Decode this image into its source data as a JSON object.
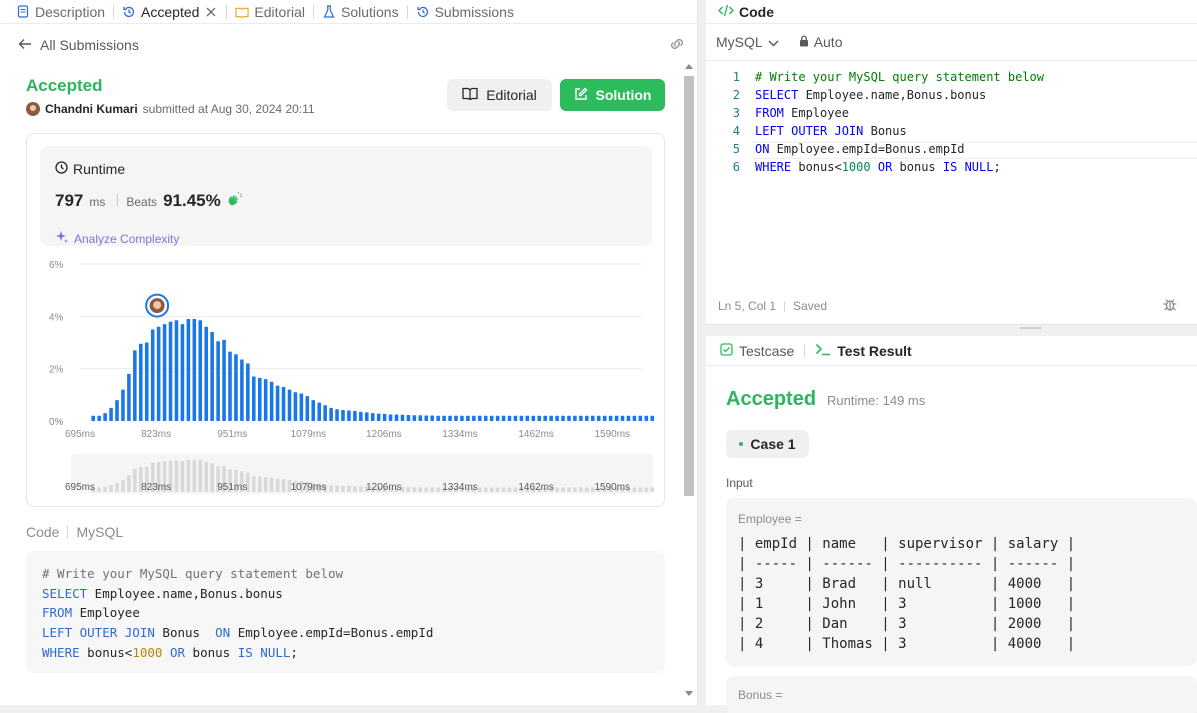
{
  "left_tabs": [
    {
      "label": "Description"
    },
    {
      "label": "Accepted"
    },
    {
      "label": "Editorial"
    },
    {
      "label": "Solutions"
    },
    {
      "label": "Submissions"
    }
  ],
  "subbar": {
    "back_label": "All Submissions"
  },
  "submission": {
    "status": "Accepted",
    "user": "Chandni Kumari",
    "submitted_text": "submitted at Aug 30, 2024 20:11",
    "editorial_button": "Editorial",
    "solution_button": "Solution"
  },
  "runtime": {
    "label": "Runtime",
    "value": "797",
    "unit": "ms",
    "beats_label": "Beats",
    "beats_value": "91.45%",
    "analyze_label": "Analyze Complexity"
  },
  "chart_data": {
    "type": "bar",
    "ylabel": "",
    "xlabel": "",
    "y_ticks": [
      "0%",
      "2%",
      "4%",
      "6%"
    ],
    "ylim": [
      0,
      6
    ],
    "x_ticks": [
      "695ms",
      "823ms",
      "951ms",
      "1079ms",
      "1206ms",
      "1334ms",
      "1462ms",
      "1590ms"
    ],
    "x_range": [
      695,
      1640
    ],
    "bar_width_ms": 10,
    "highlight_x": 823,
    "values": [
      0.2,
      0.2,
      0.3,
      0.5,
      0.8,
      1.2,
      1.8,
      2.7,
      2.95,
      3.0,
      3.5,
      3.6,
      3.7,
      3.8,
      3.85,
      3.7,
      3.9,
      3.9,
      3.85,
      3.6,
      3.4,
      3.05,
      3.1,
      2.65,
      2.55,
      2.35,
      2.2,
      1.7,
      1.65,
      1.6,
      1.5,
      1.35,
      1.3,
      1.2,
      1.1,
      1.05,
      0.95,
      0.8,
      0.7,
      0.6,
      0.5,
      0.45,
      0.42,
      0.4,
      0.38,
      0.35,
      0.33,
      0.3,
      0.28,
      0.27,
      0.25,
      0.25,
      0.24,
      0.23,
      0.22,
      0.22,
      0.21,
      0.21,
      0.2,
      0.2,
      0.2,
      0.2,
      0.2,
      0.2,
      0.2,
      0.2,
      0.2,
      0.2,
      0.2,
      0.2,
      0.2,
      0.2,
      0.2,
      0.2,
      0.2,
      0.2,
      0.2,
      0.2,
      0.2,
      0.2,
      0.2,
      0.2,
      0.2,
      0.2,
      0.2,
      0.2,
      0.2,
      0.2,
      0.2,
      0.2,
      0.2,
      0.2,
      0.2,
      0.2,
      0.2
    ],
    "colors": {
      "bar": "#1a77e8",
      "highlight_ring": "#1a77e8",
      "mini_bar": "#d9d9d9"
    }
  },
  "code_section": {
    "label": "Code",
    "language": "MySQL"
  },
  "code_lines": [
    [
      {
        "t": "# Write your MySQL query statement below",
        "c": "cb"
      }
    ],
    [
      {
        "t": "SELECT",
        "c": "kb"
      },
      {
        "t": " Employee.name,Bonus.bonus",
        "c": ""
      }
    ],
    [
      {
        "t": "FROM",
        "c": "kb"
      },
      {
        "t": " Employee",
        "c": ""
      }
    ],
    [
      {
        "t": "LEFT OUTER JOIN",
        "c": "kb"
      },
      {
        "t": " Bonus  ",
        "c": ""
      },
      {
        "t": "ON",
        "c": "kb"
      },
      {
        "t": " Employee.empId=Bonus.empId",
        "c": ""
      }
    ],
    [
      {
        "t": "WHERE",
        "c": "kb"
      },
      {
        "t": " bonus<",
        "c": ""
      },
      {
        "t": "1000",
        "c": "nb"
      },
      {
        "t": " ",
        "c": ""
      },
      {
        "t": "OR",
        "c": "kb"
      },
      {
        "t": " bonus ",
        "c": ""
      },
      {
        "t": "IS NULL",
        "c": "kb"
      },
      {
        "t": ";",
        "c": ""
      }
    ]
  ],
  "editor": {
    "title": "Code",
    "language": "MySQL",
    "mode": "Auto",
    "lines": [
      [
        {
          "t": "# Write your MySQL query statement below",
          "c": "cm"
        }
      ],
      [
        {
          "t": "SELECT",
          "c": "kw"
        },
        {
          "t": " Employee.name,Bonus.bonus",
          "c": ""
        }
      ],
      [
        {
          "t": "FROM",
          "c": "kw"
        },
        {
          "t": " Employee",
          "c": ""
        }
      ],
      [
        {
          "t": "LEFT OUTER JOIN",
          "c": "kw"
        },
        {
          "t": " Bonus",
          "c": ""
        }
      ],
      [
        {
          "t": "ON",
          "c": "kw"
        },
        {
          "t": " Employee.empId=Bonus.empId",
          "c": ""
        }
      ],
      [
        {
          "t": "WHERE",
          "c": "kw"
        },
        {
          "t": " bonus<",
          "c": ""
        },
        {
          "t": "1000",
          "c": "num"
        },
        {
          "t": " ",
          "c": ""
        },
        {
          "t": "OR",
          "c": "kw"
        },
        {
          "t": " bonus ",
          "c": ""
        },
        {
          "t": "IS",
          "c": "kw"
        },
        {
          "t": " ",
          "c": ""
        },
        {
          "t": "NULL",
          "c": "nul"
        },
        {
          "t": ";",
          "c": ""
        }
      ]
    ],
    "cursor_text": "Ln 5, Col 1",
    "saved_text": "Saved"
  },
  "result": {
    "tab_testcase": "Testcase",
    "tab_result": "Test Result",
    "status": "Accepted",
    "runtime_text": "Runtime: 149 ms",
    "case_label": "Case 1",
    "input_label": "Input",
    "table1_label": "Employee =",
    "table1_text": "| empId | name   | supervisor | salary |\n| ----- | ------ | ---------- | ------ |\n| 3     | Brad   | null       | 4000   |\n| 1     | John   | 3          | 1000   |\n| 2     | Dan    | 3          | 2000   |\n| 4     | Thomas | 3          | 4000   |",
    "table2_label": "Bonus ="
  }
}
